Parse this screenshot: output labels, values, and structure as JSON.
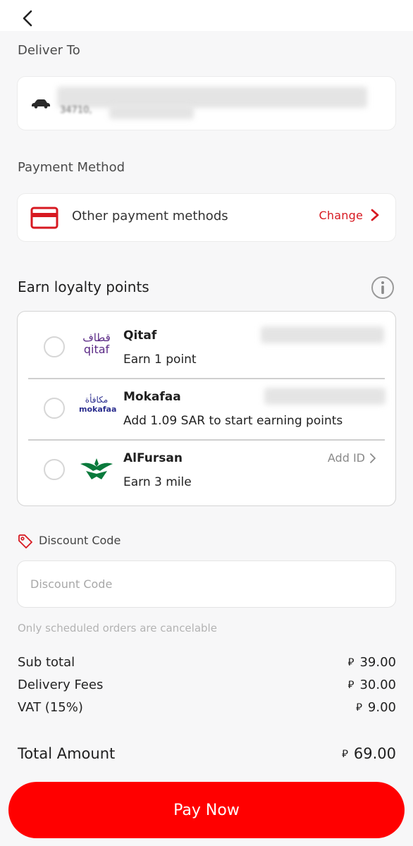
{
  "deliver": {
    "label": "Deliver To",
    "address_partial": "34710, "
  },
  "payment": {
    "section_label": "Payment Method",
    "method_label": "Other payment methods",
    "change_label": "Change"
  },
  "loyalty": {
    "title": "Earn loyalty points",
    "programs": [
      {
        "name": "Qitaf",
        "desc": "Earn 1 point",
        "logo_ar": "قطاف",
        "logo_en": "qitaf"
      },
      {
        "name": "Mokafaa",
        "desc": "Add 1.09 SAR to start earning points",
        "logo_ar": "مكافأة",
        "logo_en": "mokafaa"
      },
      {
        "name": "AlFursan",
        "desc": "Earn 3 mile",
        "action": "Add ID"
      }
    ]
  },
  "discount": {
    "label": "Discount Code",
    "placeholder": "Discount Code",
    "note": "Only scheduled orders are cancelable"
  },
  "summary": {
    "currency_symbol": "⃁",
    "rows": [
      {
        "label": "Sub total",
        "value": "39.00"
      },
      {
        "label": "Delivery Fees",
        "value": "30.00"
      },
      {
        "label": "VAT (15%)",
        "value": "9.00"
      }
    ],
    "total_label": "Total Amount",
    "total_value": "69.00"
  },
  "pay_button": "Pay Now",
  "colors": {
    "accent": "#ff0000",
    "link_red": "#d71921",
    "qitaf_purple": "#5b2a86",
    "mokafaa_blue": "#2c2f8f",
    "fursan_green": "#0a7a3c"
  }
}
